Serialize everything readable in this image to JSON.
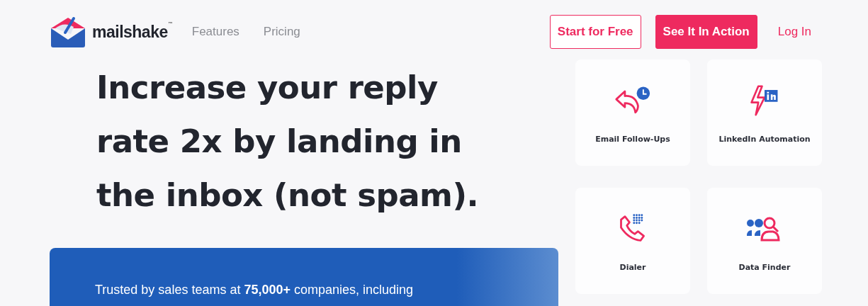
{
  "brand": {
    "name": "mailshake",
    "trademark": "™"
  },
  "nav": [
    {
      "label": "Features"
    },
    {
      "label": "Pricing"
    }
  ],
  "actions": [
    {
      "label": "Start for Free",
      "kind": "outline"
    },
    {
      "label": "See It In Action",
      "kind": "solid"
    },
    {
      "label": "Log In",
      "kind": "link"
    }
  ],
  "headline": "Increase your reply rate 2x by landing in the inbox (not spam).",
  "trust_banner": "Trusted by sales teams at **75,000+** companies, including",
  "features": [
    {
      "label": "Email Follow-Ups",
      "kind": "follow-up"
    },
    {
      "label": "LinkedIn Automation",
      "kind": "linkedin"
    },
    {
      "label": "Dialer",
      "kind": "dialer"
    },
    {
      "label": "Data Finder",
      "kind": "data-finder"
    }
  ]
}
